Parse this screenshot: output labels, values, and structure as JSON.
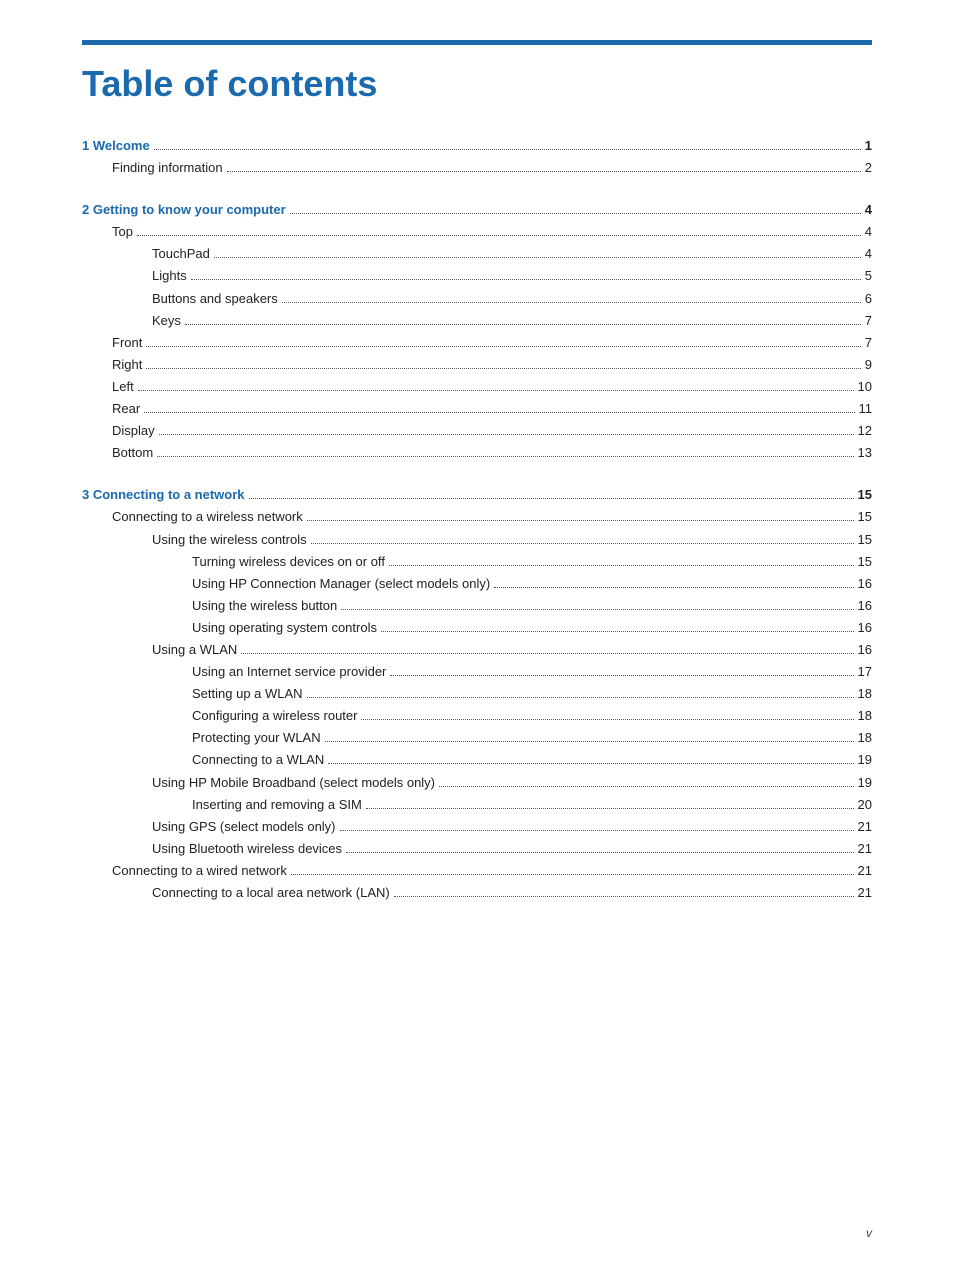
{
  "header": {
    "title": "Table of contents"
  },
  "footer": {
    "page": "v"
  },
  "toc": {
    "entries": [
      {
        "level": "chapter",
        "label": "1  Welcome",
        "page": "1",
        "gap": true
      },
      {
        "level": "l1",
        "label": "Finding information",
        "page": "2",
        "gap": false
      },
      {
        "level": "chapter",
        "label": "2  Getting to know your computer",
        "page": "4",
        "gap": true
      },
      {
        "level": "l1",
        "label": "Top",
        "page": "4",
        "gap": false
      },
      {
        "level": "l2",
        "label": "TouchPad",
        "page": "4",
        "gap": false
      },
      {
        "level": "l2",
        "label": "Lights",
        "page": "5",
        "gap": false
      },
      {
        "level": "l2",
        "label": "Buttons and speakers",
        "page": "6",
        "gap": false
      },
      {
        "level": "l2",
        "label": "Keys",
        "page": "7",
        "gap": false
      },
      {
        "level": "l1",
        "label": "Front",
        "page": "7",
        "gap": false
      },
      {
        "level": "l1",
        "label": "Right",
        "page": "9",
        "gap": false
      },
      {
        "level": "l1",
        "label": "Left",
        "page": "10",
        "gap": false
      },
      {
        "level": "l1",
        "label": "Rear",
        "page": "11",
        "gap": false
      },
      {
        "level": "l1",
        "label": "Display",
        "page": "12",
        "gap": false
      },
      {
        "level": "l1",
        "label": "Bottom",
        "page": "13",
        "gap": false
      },
      {
        "level": "chapter",
        "label": "3  Connecting to a network",
        "page": "15",
        "gap": true
      },
      {
        "level": "l1",
        "label": "Connecting to a wireless network",
        "page": "15",
        "gap": false
      },
      {
        "level": "l2",
        "label": "Using the wireless controls",
        "page": "15",
        "gap": false
      },
      {
        "level": "l3",
        "label": "Turning wireless devices on or off",
        "page": "15",
        "gap": false
      },
      {
        "level": "l3",
        "label": "Using HP Connection Manager (select models only)",
        "page": "16",
        "gap": false
      },
      {
        "level": "l3",
        "label": "Using the wireless button",
        "page": "16",
        "gap": false
      },
      {
        "level": "l3",
        "label": "Using operating system controls",
        "page": "16",
        "gap": false
      },
      {
        "level": "l2",
        "label": "Using a WLAN",
        "page": "16",
        "gap": false
      },
      {
        "level": "l3",
        "label": "Using an Internet service provider",
        "page": "17",
        "gap": false
      },
      {
        "level": "l3",
        "label": "Setting up a WLAN",
        "page": "18",
        "gap": false
      },
      {
        "level": "l3",
        "label": "Configuring a wireless router",
        "page": "18",
        "gap": false
      },
      {
        "level": "l3",
        "label": "Protecting your WLAN",
        "page": "18",
        "gap": false
      },
      {
        "level": "l3",
        "label": "Connecting to a WLAN",
        "page": "19",
        "gap": false
      },
      {
        "level": "l2",
        "label": "Using HP Mobile Broadband (select models only)",
        "page": "19",
        "gap": false
      },
      {
        "level": "l3",
        "label": "Inserting and removing a SIM",
        "page": "20",
        "gap": false
      },
      {
        "level": "l2",
        "label": "Using GPS (select models only)",
        "page": "21",
        "gap": false
      },
      {
        "level": "l2",
        "label": "Using Bluetooth wireless devices",
        "page": "21",
        "gap": false
      },
      {
        "level": "l1",
        "label": "Connecting to a wired network",
        "page": "21",
        "gap": false
      },
      {
        "level": "l2",
        "label": "Connecting to a local area network (LAN)",
        "page": "21",
        "gap": false
      }
    ]
  }
}
